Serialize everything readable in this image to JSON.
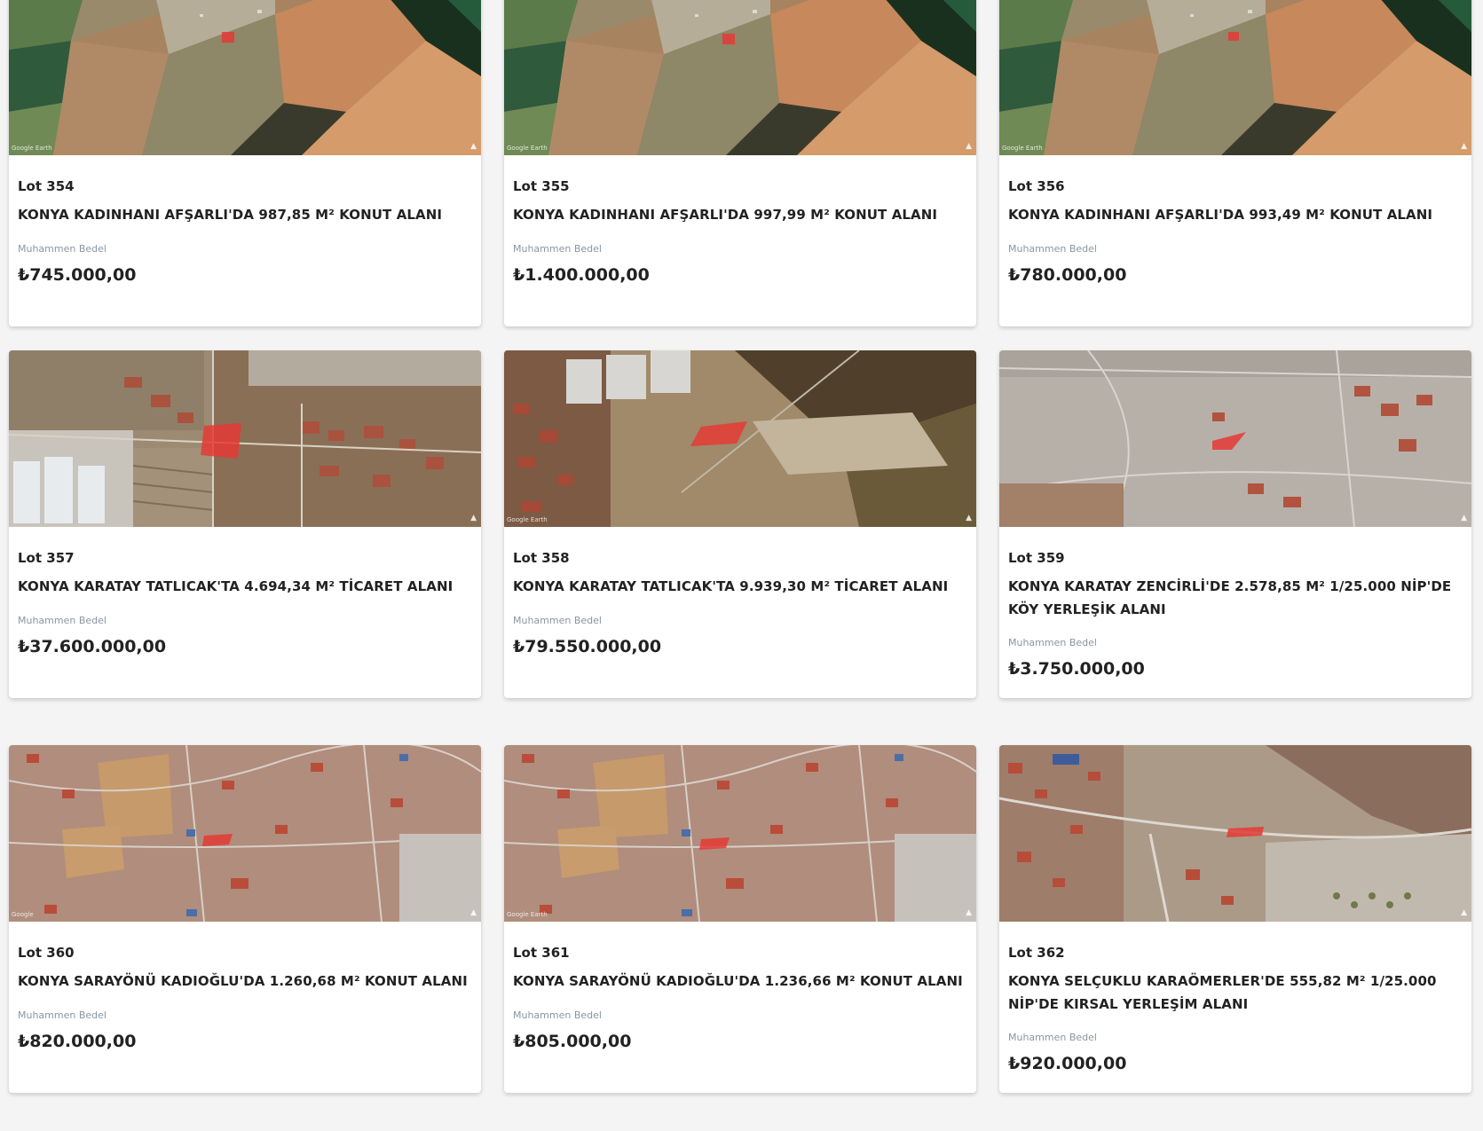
{
  "cards": [
    {
      "lot": "Lot 354",
      "title": "KONYA KADINHANI AFŞARLI'DA 987,85 M² KONUT ALANI",
      "estimate_label": "Muhammen Bedel",
      "price": "₺745.000,00",
      "image_credit": "Google Earth",
      "image": "satellite-farmland-image"
    },
    {
      "lot": "Lot 355",
      "title": "KONYA KADINHANI AFŞARLI'DA 997,99 M² KONUT ALANI",
      "estimate_label": "Muhammen Bedel",
      "price": "₺1.400.000,00",
      "image_credit": "Google Earth",
      "image": "satellite-farmland-image"
    },
    {
      "lot": "Lot 356",
      "title": "KONYA KADINHANI AFŞARLI'DA 993,49 M² KONUT ALANI",
      "estimate_label": "Muhammen Bedel",
      "price": "₺780.000,00",
      "image_credit": "Google Earth",
      "image": "satellite-farmland-image"
    },
    {
      "lot": "Lot 357",
      "title": "KONYA KARATAY TATLICAK'TA 4.694,34 M² TİCARET ALANI",
      "estimate_label": "Muhammen Bedel",
      "price": "₺37.600.000,00",
      "image_credit": "",
      "image": "satellite-village-image"
    },
    {
      "lot": "Lot 358",
      "title": "KONYA KARATAY TATLICAK'TA 9.939,30 M² TİCARET ALANI",
      "estimate_label": "Muhammen Bedel",
      "price": "₺79.550.000,00",
      "image_credit": "Google Earth",
      "image": "satellite-industrial-image"
    },
    {
      "lot": "Lot 359",
      "title": "KONYA KARATAY ZENCİRLİ'DE 2.578,85 M² 1/25.000 NİP'DE KÖY YERLEŞİK ALANI",
      "estimate_label": "Muhammen Bedel",
      "price": "₺3.750.000,00",
      "image_credit": "",
      "image": "satellite-grey-terrain-image"
    },
    {
      "lot": "Lot 360",
      "title": "KONYA SARAYÖNÜ KADIOĞLU'DA 1.260,68 M² KONUT ALANI",
      "estimate_label": "Muhammen Bedel",
      "price": "₺820.000,00",
      "image_credit": "Google",
      "image": "satellite-village-red-image"
    },
    {
      "lot": "Lot 361",
      "title": "KONYA SARAYÖNÜ KADIOĞLU'DA 1.236,66 M² KONUT ALANI",
      "estimate_label": "Muhammen Bedel",
      "price": "₺805.000,00",
      "image_credit": "Google Earth",
      "image": "satellite-village-red-image"
    },
    {
      "lot": "Lot 362",
      "title": "KONYA SELÇUKLU KARAÖMERLER'DE 555,82 M² 1/25.000 NİP'DE KIRSAL YERLEŞİM ALANI",
      "estimate_label": "Muhammen Bedel",
      "price": "₺920.000,00",
      "image_credit": "",
      "image": "satellite-rocky-village-image"
    }
  ],
  "colors": {
    "plot_highlight": "#e53935",
    "page_bg": "#f4f4f4",
    "card_bg": "#ffffff",
    "label_grey": "#8a96a0",
    "text_dark": "#222222"
  }
}
